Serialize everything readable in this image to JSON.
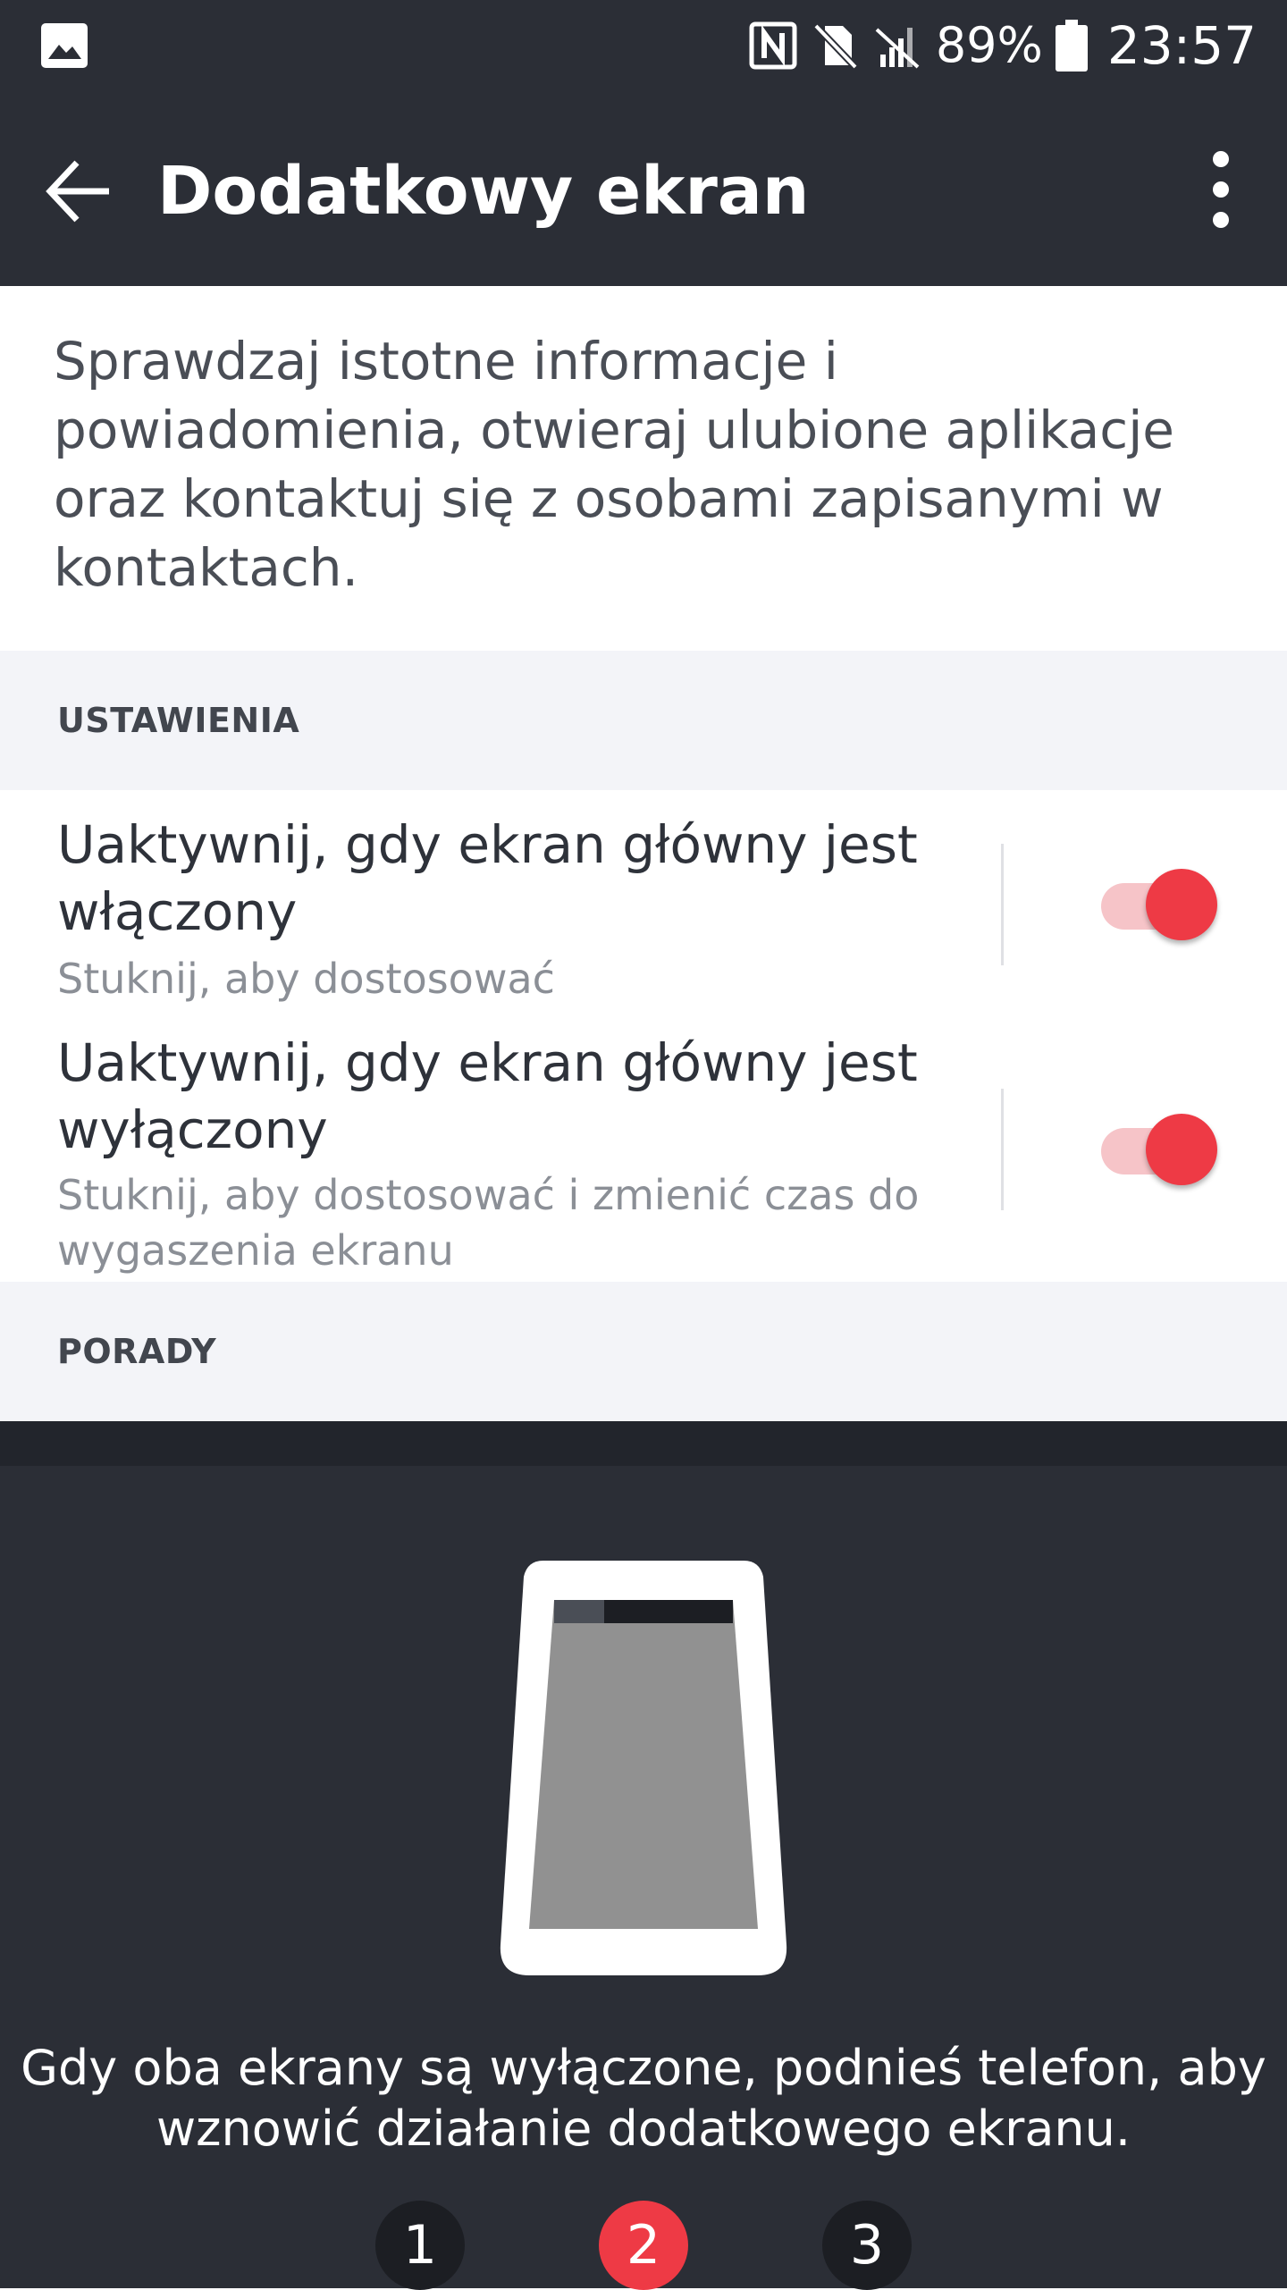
{
  "status_bar": {
    "left_icon": "image-notification-icon",
    "icons": [
      "nfc-icon",
      "no-sim-icon",
      "no-signal-icon"
    ],
    "battery_percent": "89%",
    "time": "23:57"
  },
  "app_bar": {
    "back_icon": "arrow-back-icon",
    "title": "Dodatkowy ekran",
    "overflow_icon": "more-vert-icon"
  },
  "description": "Sprawdzaj istotne informacje i powiadomienia, otwieraj ulubione aplikacje oraz kontaktuj się z osobami zapisanymi w kontaktach.",
  "sections": {
    "settings_label": "USTAWIENIA",
    "tips_label": "PORADY"
  },
  "settings": [
    {
      "title": "Uaktywnij, gdy ekran główny jest włączony",
      "subtitle": "Stuknij, aby dostosować",
      "enabled": true
    },
    {
      "title": "Uaktywnij, gdy ekran główny jest wyłączony",
      "subtitle": "Stuknij, aby dostosować i zmienić czas do wygaszenia ekranu",
      "enabled": true
    }
  ],
  "tips": {
    "text": "Gdy oba ekrany są wyłączone, podnieś telefon, aby wznowić działanie dodatkowego ekranu.",
    "pages": [
      "1",
      "2",
      "3"
    ],
    "active_page": "2"
  },
  "colors": {
    "header_bg": "#2b2e36",
    "accent": "#ee3a45",
    "section_bg": "#f3f4f8"
  }
}
